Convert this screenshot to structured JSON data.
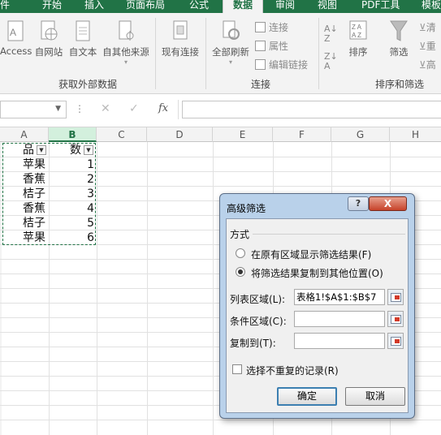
{
  "tabs": [
    "件",
    "开始",
    "插入",
    "页面布局",
    "公式",
    "数据",
    "审阅",
    "视图",
    "PDF工具",
    "模板"
  ],
  "active_tab": "数据",
  "ribbon": {
    "access": "Access",
    "web": "自网站",
    "text": "自文本",
    "other": "自其他来源",
    "existing": "现有连接",
    "refresh_all": "全部刷新",
    "connections": "连接",
    "properties": "属性",
    "edit_links": "编辑链接",
    "sort": "排序",
    "filter": "筛选",
    "clear_partial": "清",
    "reapply_partial": "重",
    "advanced_partial": "高",
    "group_external": "获取外部数据",
    "group_connections": "连接",
    "group_sort_filter": "排序和筛选"
  },
  "formula_bar": {
    "name_box": "",
    "fx": "fx",
    "formula": ""
  },
  "columns": [
    "A",
    "B",
    "C",
    "D",
    "E",
    "F",
    "G",
    "H"
  ],
  "cells": {
    "header_a": "品",
    "header_b": "数",
    "rows": [
      {
        "a": "苹果",
        "b": "1"
      },
      {
        "a": "香蕉",
        "b": "2"
      },
      {
        "a": "桔子",
        "b": "3"
      },
      {
        "a": "香蕉",
        "b": "4"
      },
      {
        "a": "桔子",
        "b": "5"
      },
      {
        "a": "苹果",
        "b": "6"
      }
    ]
  },
  "dialog": {
    "title": "高级筛选",
    "help": "?",
    "close": "X",
    "section": "方式",
    "option1": "在原有区域显示筛选结果(F)",
    "option2": "将筛选结果复制到其他位置(O)",
    "list_label": "列表区域(L):",
    "list_value": "表格1!$A$1:$B$7",
    "criteria_label": "条件区域(C):",
    "criteria_value": "",
    "copyto_label": "复制到(T):",
    "copyto_value": "",
    "unique_label": "选择不重复的记录(R)",
    "ok": "确定",
    "cancel": "取消"
  }
}
